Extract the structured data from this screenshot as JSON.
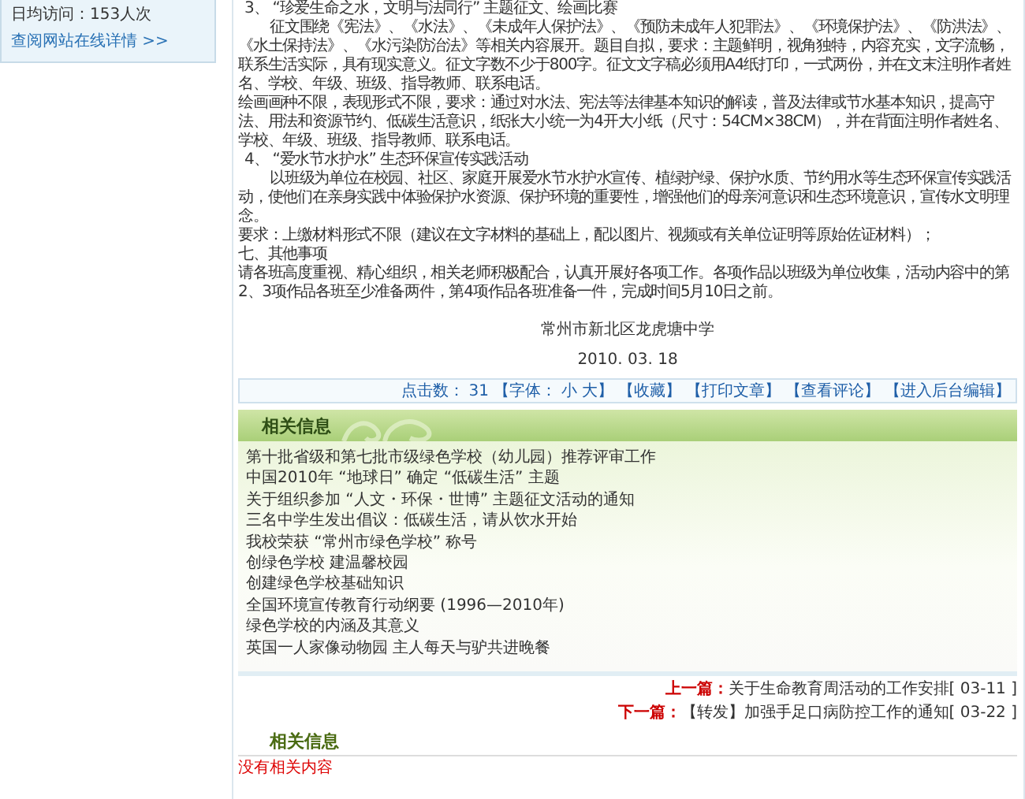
{
  "sidebar": {
    "stats": [
      {
        "label": "日均访问：153人次"
      }
    ],
    "link": "查阅网站在线详情 >>"
  },
  "article": {
    "paragraphs": [
      {
        "kind": "heading",
        "text": "3、 “珍爱生命之水，文明与法同行” 主题征文、绘画比赛"
      },
      {
        "kind": "indent",
        "text": "征文围绕《宪法》、《水法》、《未成年人保护法》、《预防未成年人犯罪法》、《环境保护法》、《防洪法》、《水土保持法》、《水污染防治法》等相关内容展开。题目自拟，要求：主题鲜明，视角独特，内容充实，文字流畅，联系生活实际，具有现实意义。征文字数不少于800字。征文文字稿必须用A4纸打印，一式两份，并在文末注明作者姓名、学校、年级、班级、指导教师、联系电话。"
      },
      {
        "kind": "plain",
        "text": "绘画画种不限，表现形式不限，要求：通过对水法、宪法等法律基本知识的解读，普及法律或节水基本知识，提高守法、用法和资源节约、低碳生活意识，纸张大小统一为4开大小纸（尺寸：54CM×38CM），并在背面注明作者姓名、学校、年级、班级、指导教师、联系电话。"
      },
      {
        "kind": "heading",
        "text": "4、 “爱水节水护水” 生态环保宣传实践活动"
      },
      {
        "kind": "indent",
        "text": "以班级为单位在校园、社区、家庭开展爱水节水护水宣传、植绿护绿、保护水质、节约用水等生态环保宣传实践活动，使他们在亲身实践中体验保护水资源、保护环境的重要性，增强他们的母亲河意识和生态环境意识，宣传水文明理念。"
      },
      {
        "kind": "plain",
        "text": "要求：上缴材料形式不限（建议在文字材料的基础上，配以图片、视频或有关单位证明等原始佐证材料）；"
      },
      {
        "kind": "plain",
        "text": "七、其他事项"
      },
      {
        "kind": "plain",
        "text": "请各班高度重视、精心组织，相关老师积极配合，认真开展好各项工作。各项作品以班级为单位收集，活动内容中的第2、3项作品各班至少准备两件，第4项作品各班准备一件，完成时间5月10日之前。"
      }
    ],
    "signature": "常州市新北区龙虎塘中学",
    "date": "2010. 03. 18"
  },
  "toolbar": {
    "hits_label": "点击数：",
    "hits": "31",
    "font_label": "【字体：",
    "font_small": "小",
    "font_large": "大】",
    "actions": [
      "【收藏】",
      "【打印文章】",
      "【查看评论】",
      "【进入后台编辑】"
    ]
  },
  "related": {
    "title": "相关信息",
    "items": [
      "第十批省级和第七批市级绿色学校（幼儿园）推荐评审工作",
      "中国2010年 “地球日” 确定 “低碳生活” 主题",
      "关于组织参加 “人文・环保・世博” 主题征文活动的通知",
      "三名中学生发出倡议：低碳生活，请从饮水开始",
      "我校荣获 “常州市绿色学校” 称号",
      "创绿色学校 建温馨校园",
      "创建绿色学校基础知识",
      "全国环境宣传教育行动纲要 (1996—2010年)",
      "绿色学校的内涵及其意义",
      "英国一人家像动物园 主人每天与驴共进晚餐"
    ]
  },
  "nav": [
    {
      "label": "上一篇：",
      "title": "关于生命教育周活动的工作安排[ 03-11 ]"
    },
    {
      "label": "下一篇：",
      "title": "【转发】加强手足口病防控工作的通知[ 03-22 ]"
    }
  ],
  "related2": {
    "title": "相关信息",
    "empty": "没有相关内容"
  }
}
